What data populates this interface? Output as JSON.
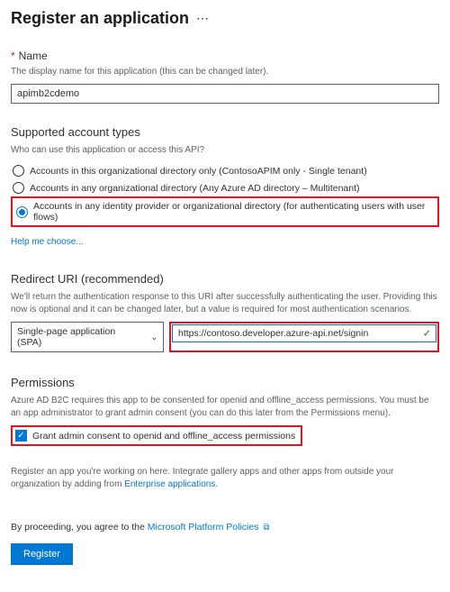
{
  "header": {
    "title": "Register an application"
  },
  "name": {
    "label": "Name",
    "help": "The display name for this application (this can be changed later).",
    "value": "apimb2cdemo"
  },
  "account_types": {
    "title": "Supported account types",
    "help": "Who can use this application or access this API?",
    "options": [
      "Accounts in this organizational directory only (ContosoAPIM only - Single tenant)",
      "Accounts in any organizational directory (Any Azure AD directory – Multitenant)",
      "Accounts in any identity provider or organizational directory (for authenticating users with user flows)"
    ],
    "help_link": "Help me choose..."
  },
  "redirect": {
    "title": "Redirect URI (recommended)",
    "help": "We'll return the authentication response to this URI after successfully authenticating the user. Providing this now is optional and it can be changed later, but a value is required for most authentication scenarios.",
    "platform": "Single-page application (SPA)",
    "uri": "https://contoso.developer.azure-api.net/signin"
  },
  "permissions": {
    "title": "Permissions",
    "help": "Azure AD B2C requires this app to be consented for openid and offline_access permissions. You must be an app administrator to grant admin consent (you can do this later from the Permissions menu).",
    "checkbox_label": "Grant admin consent to openid and offline_access permissions"
  },
  "footer": {
    "note_prefix": "Register an app you're working on here. Integrate gallery apps and other apps from outside your organization by adding from ",
    "note_link": "Enterprise applications",
    "note_suffix": ".",
    "policy_prefix": "By proceeding, you agree to the ",
    "policy_link": "Microsoft Platform Policies",
    "register": "Register"
  }
}
